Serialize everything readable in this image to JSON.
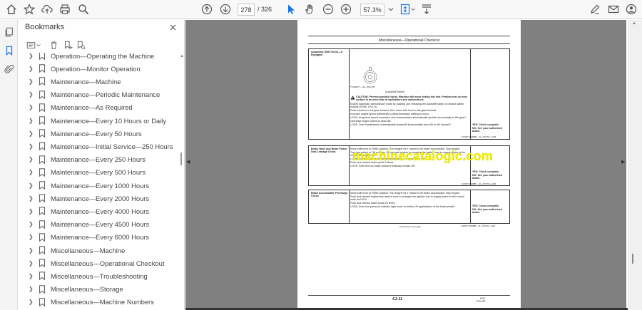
{
  "toolbar": {
    "current_page": "278",
    "total_pages": "/ 326",
    "zoom": "57.3%"
  },
  "bookmarks": {
    "title": "Bookmarks",
    "items": [
      {
        "label": "Operation—Operating the Machine"
      },
      {
        "label": "Operation—Monitor Operation"
      },
      {
        "label": "Maintenance—Machine"
      },
      {
        "label": "Maintenance—Periodic Maintenance"
      },
      {
        "label": "Maintenance—As Required"
      },
      {
        "label": "Maintenance—Every 10 Hours or Daily"
      },
      {
        "label": "Maintenance—Every 50 Hours"
      },
      {
        "label": "Maintenance—Initial Service—250 Hours"
      },
      {
        "label": "Maintenance—Every 250 Hours"
      },
      {
        "label": "Maintenance—Every 500 Hours"
      },
      {
        "label": "Maintenance—Every 1000 Hours"
      },
      {
        "label": "Maintenance—Every 2000 Hours"
      },
      {
        "label": "Maintenance—Every 4000 Hours"
      },
      {
        "label": "Maintenance—Every 4500 Hours"
      },
      {
        "label": "Maintenance—Every 6000 Hours"
      },
      {
        "label": "Miscellaneous—Machine"
      },
      {
        "label": "Miscellaneous—Operational Checkout"
      },
      {
        "label": "Miscellaneous—Troubleshooting"
      },
      {
        "label": "Miscellaneous—Storage"
      },
      {
        "label": "Miscellaneous—Machine Numbers"
      }
    ]
  },
  "page": {
    "section_title": "Miscellaneous—Operational Checkout",
    "box1": {
      "heading": "Automatic Shift Check—If Equipped",
      "image_code": "TX1040877 —UN—25OCT08",
      "caption": "Autoshift Switch",
      "caution": "CAUTION: Prevent possible injury. Machine will move during this test. Perform test on level surface in an area clear of bystanders and obstructions.",
      "lines": [
        "Enable automatic transmission mode by pushing and releasing the autoshift button on sealed switch module (SSM). LED on.",
        "Drive machine in 1st gear forward, then move shift lever to 6th gear forward.",
        "Increase engine speed sufficiently to allow automatic shifting to occur.",
        "LOOK: As ground speed increases, does transmission automatically upshift incrementally to 6th gear?",
        "Decrease engine speed to slow idle.",
        "LOOK: Does transmission automatically downshift incrementally from 6th to 4th forward?"
      ],
      "yes": "YES: Check complete.",
      "no": "NO: See your authorized dealer.",
      "code": "OUO6077,0000BB6 —19—27OCT10—42/46"
    },
    "box2": {
      "heading": "Brake Valve and Brake Piston Seal Leakage Check",
      "lines": [
        "Move shift lever to PARK position. Run engine for 1 minute to fill brake accumulator. Stop engine.",
        "Turn key switch to ON position. Do not start engine to energize the ignition and to supply power to the control units and ECU.",
        "LOOK: Does the brake low-pressure indicator on monitor turn off?",
        "Push and release brake pedal 3 times.",
        "LOOK: Does the low brake pressure indicator remain off?"
      ],
      "yes": "YES: Check complete.",
      "no": "NO: See your authorized dealer.",
      "code": "OUO6077,0000BB7 —19—27OCT10—43/46"
    },
    "box3": {
      "heading": "Brake Accumulator Precharge Check",
      "lines": [
        "Move shift lever to PARK position. Run engine for 1 minute to fill brake accumulator. Stop engine.",
        "Push and release engine start switch once to energize the ignition and to supply power to the control units and ECU.",
        "Push and release brake pedal 20 times.",
        "LOOK: Does low-pressure indicator light come on before 20 applications of the brake pedal?"
      ],
      "yes": "YES: Check complete.",
      "no": "NO: See your authorized dealer.",
      "continued": "Continued on next page",
      "code": "OUO6077,0000BB8 —19—27OCT10—44/46"
    },
    "watermark": "machinecatalogic.com",
    "page_number": "4.2-11",
    "page_code": "1917\nPN=278"
  }
}
